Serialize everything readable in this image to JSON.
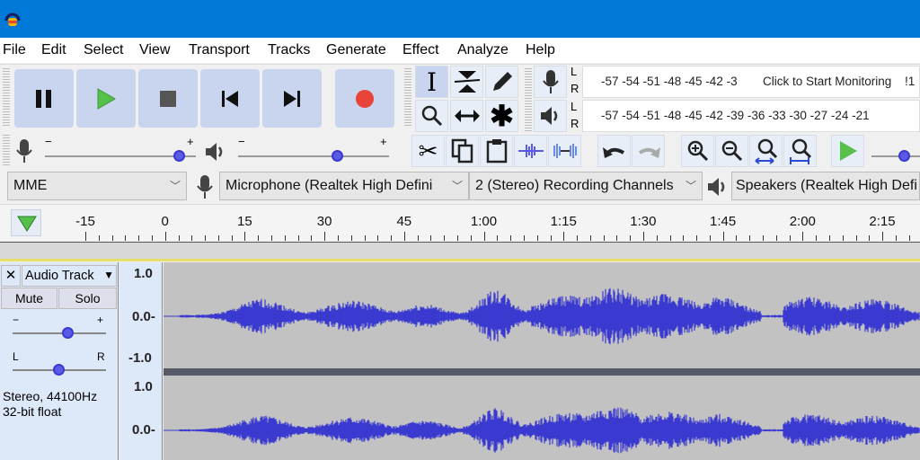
{
  "menu": [
    "File",
    "Edit",
    "Select",
    "View",
    "Transport",
    "Tracks",
    "Generate",
    "Effect",
    "Analyze",
    "Help"
  ],
  "transport": [
    {
      "icon": "pause-icon"
    },
    {
      "icon": "play-icon"
    },
    {
      "icon": "stop-icon"
    },
    {
      "icon": "skip-to-start-icon"
    },
    {
      "icon": "skip-to-end-icon"
    },
    {
      "icon": "record-icon"
    }
  ],
  "meters": {
    "record_ticks": "-57 -54 -51 -48 -45 -42 -3",
    "record_prompt": "Click to Start Monitoring",
    "record_tail": "!1",
    "play_ticks": "-57 -54 -51 -48 -45 -42 -39 -36 -33 -30 -27 -24 -21",
    "L": "L",
    "R": "R"
  },
  "mixer": {
    "minus": "−",
    "plus": "+"
  },
  "devices": {
    "host": "MME",
    "input": "Microphone (Realtek High Defini",
    "channels": "2 (Stereo) Recording Channels",
    "output": "Speakers (Realtek High Defi"
  },
  "timeline": [
    "-15",
    "0",
    "15",
    "30",
    "45",
    "1:00",
    "1:15",
    "1:30",
    "1:45",
    "2:00",
    "2:15"
  ],
  "track": {
    "close": "✕",
    "name": "Audio Track",
    "mute": "Mute",
    "solo": "Solo",
    "gain_minus": "−",
    "gain_plus": "+",
    "pan_left": "L",
    "pan_right": "R",
    "info1": "Stereo, 44100Hz",
    "info2": "32-bit float",
    "gain": 0.6,
    "pan": 0.5
  },
  "ruler": {
    "top": "1.0",
    "mid": "0.0-",
    "bottom": "-1.0"
  },
  "colors": {
    "titlebar": "#0078d7",
    "waveform": "#3a3ad0",
    "track_bg": "#c2c2c2",
    "record": "#e8443a",
    "play": "#55c04a"
  }
}
